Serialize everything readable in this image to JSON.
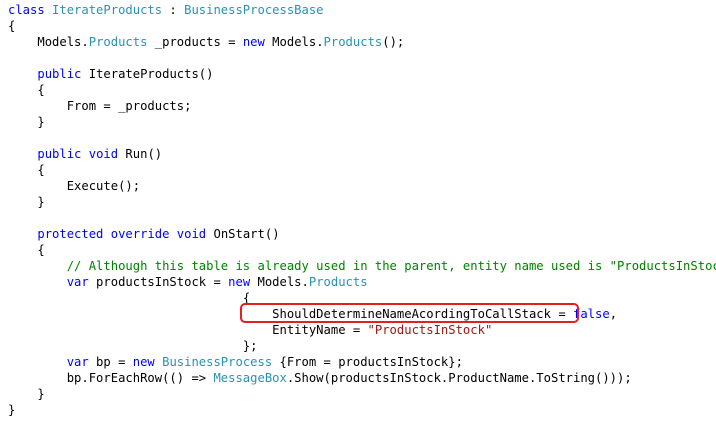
{
  "code": {
    "language": "C#",
    "colors": {
      "keyword": "#0000ff",
      "type": "#2b91af",
      "string": "#a31515",
      "comment": "#008000",
      "highlight_border": "#e0221f"
    },
    "lines": [
      {
        "indent": "",
        "tokens": [
          [
            "kw",
            "class"
          ],
          [
            "t",
            " "
          ],
          [
            "ty",
            "IterateProducts"
          ],
          [
            "t",
            " : "
          ],
          [
            "ty",
            "BusinessProcessBase"
          ]
        ]
      },
      {
        "indent": "",
        "tokens": [
          [
            "t",
            "{"
          ]
        ]
      },
      {
        "indent": "    ",
        "tokens": [
          [
            "t",
            "Models."
          ],
          [
            "ty",
            "Products"
          ],
          [
            "t",
            " _products = "
          ],
          [
            "kw",
            "new"
          ],
          [
            "t",
            " Models."
          ],
          [
            "ty",
            "Products"
          ],
          [
            "t",
            "();"
          ]
        ]
      },
      {
        "indent": "",
        "tokens": []
      },
      {
        "indent": "    ",
        "tokens": [
          [
            "kw",
            "public"
          ],
          [
            "t",
            " IterateProducts()"
          ]
        ]
      },
      {
        "indent": "    ",
        "tokens": [
          [
            "t",
            "{"
          ]
        ]
      },
      {
        "indent": "        ",
        "tokens": [
          [
            "t",
            "From = _products;"
          ]
        ]
      },
      {
        "indent": "    ",
        "tokens": [
          [
            "t",
            "}"
          ]
        ]
      },
      {
        "indent": "",
        "tokens": []
      },
      {
        "indent": "    ",
        "tokens": [
          [
            "kw",
            "public"
          ],
          [
            "t",
            " "
          ],
          [
            "kw",
            "void"
          ],
          [
            "t",
            " Run()"
          ]
        ]
      },
      {
        "indent": "    ",
        "tokens": [
          [
            "t",
            "{"
          ]
        ]
      },
      {
        "indent": "        ",
        "tokens": [
          [
            "t",
            "Execute();"
          ]
        ]
      },
      {
        "indent": "    ",
        "tokens": [
          [
            "t",
            "}"
          ]
        ]
      },
      {
        "indent": "",
        "tokens": []
      },
      {
        "indent": "    ",
        "tokens": [
          [
            "kw",
            "protected"
          ],
          [
            "t",
            " "
          ],
          [
            "kw",
            "override"
          ],
          [
            "t",
            " "
          ],
          [
            "kw",
            "void"
          ],
          [
            "t",
            " OnStart()"
          ]
        ]
      },
      {
        "indent": "    ",
        "tokens": [
          [
            "t",
            "{"
          ]
        ]
      },
      {
        "indent": "        ",
        "tokens": [
          [
            "cm",
            "// Although this table is already used in the parent, entity name used is \"ProductsInStock\""
          ]
        ]
      },
      {
        "indent": "        ",
        "tokens": [
          [
            "kw",
            "var"
          ],
          [
            "t",
            " productsInStock = "
          ],
          [
            "kw",
            "new"
          ],
          [
            "t",
            " Models."
          ],
          [
            "ty",
            "Products"
          ]
        ]
      },
      {
        "indent": "                                ",
        "tokens": [
          [
            "t",
            "{"
          ]
        ]
      },
      {
        "indent": "                                    ",
        "tokens": [
          [
            "t",
            "ShouldDetermineNameAcordingToCallStack = "
          ],
          [
            "kw",
            "false"
          ],
          [
            "t",
            ","
          ]
        ]
      },
      {
        "indent": "                                    ",
        "tokens": [
          [
            "t",
            "EntityName = "
          ],
          [
            "str",
            "\"ProductsInStock\""
          ]
        ]
      },
      {
        "indent": "                                ",
        "tokens": [
          [
            "t",
            "};"
          ]
        ]
      },
      {
        "indent": "        ",
        "tokens": [
          [
            "kw",
            "var"
          ],
          [
            "t",
            " bp = "
          ],
          [
            "kw",
            "new"
          ],
          [
            "t",
            " "
          ],
          [
            "ty",
            "BusinessProcess"
          ],
          [
            "t",
            " {From = productsInStock};"
          ]
        ]
      },
      {
        "indent": "        ",
        "tokens": [
          [
            "t",
            "bp.ForEachRow(() => "
          ],
          [
            "ty",
            "MessageBox"
          ],
          [
            "t",
            ".Show(productsInStock.ProductName.ToString()));"
          ]
        ]
      },
      {
        "indent": "    ",
        "tokens": [
          [
            "t",
            "}"
          ]
        ]
      },
      {
        "indent": "",
        "tokens": [
          [
            "t",
            "}"
          ]
        ]
      }
    ]
  }
}
